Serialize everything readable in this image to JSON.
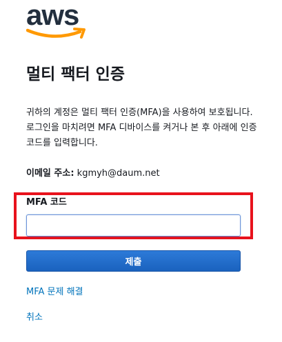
{
  "logo": {
    "text": "aws",
    "smile_color": "#ff9900",
    "text_color": "#232f3e"
  },
  "page": {
    "title": "멀티 팩터 인증",
    "description": "귀하의 계정은 멀티 팩터 인증(MFA)을 사용하여 보호됩니다. 로그인을 마치려면 MFA 디바이스를 켜거나 본 후 아래에 인증 코드를 입력합니다."
  },
  "account": {
    "email_label": "이메일 주소:",
    "email_value": "kgmyh@daum.net"
  },
  "form": {
    "mfa_label": "MFA 코드",
    "mfa_value": "",
    "submit_label": "제출",
    "highlight_color": "#e8121c",
    "button_color": "#1a62be"
  },
  "links": {
    "troubleshoot": "MFA 문제 해결",
    "cancel": "취소",
    "link_color": "#0073bb"
  }
}
